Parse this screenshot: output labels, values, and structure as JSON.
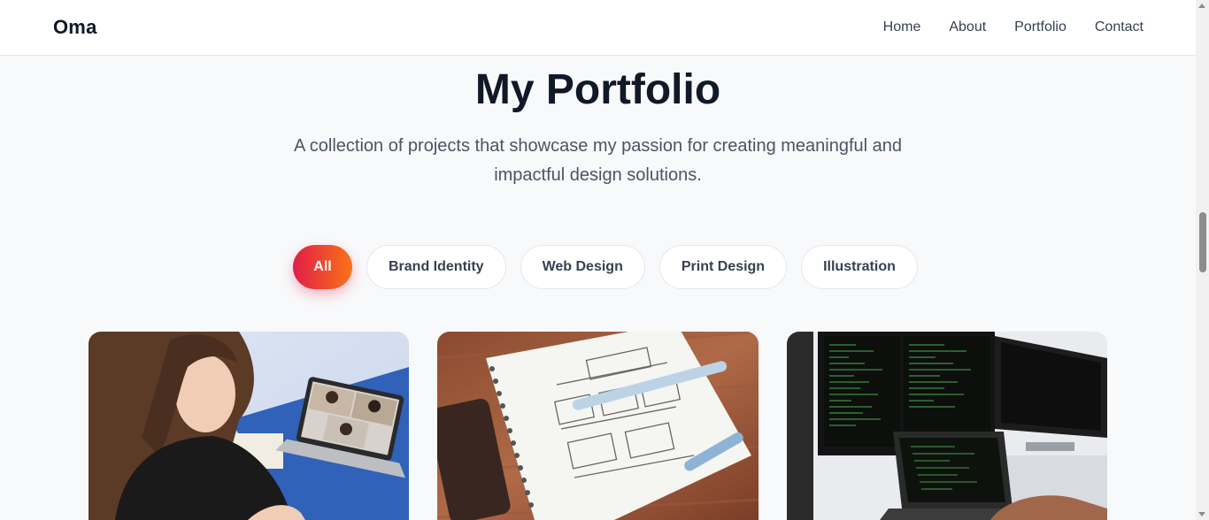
{
  "brand": {
    "logo": "Oma"
  },
  "nav": {
    "items": [
      "Home",
      "About",
      "Portfolio",
      "Contact"
    ]
  },
  "hero": {
    "title": "My Portfolio",
    "subtitle": "A collection of projects that showcase my passion for creating meaningful and impactful design solutions."
  },
  "filters": {
    "items": [
      "All",
      "Brand Identity",
      "Web Design",
      "Print Design",
      "Illustration"
    ],
    "active": "All"
  },
  "projects": [
    {
      "image": "woman-video-call-laptop-photo"
    },
    {
      "image": "wireframe-sketch-notebook-photo"
    },
    {
      "image": "code-monitors-laptop-photo"
    }
  ],
  "colors": {
    "accent_start": "#e11d48",
    "accent_end": "#f97316",
    "background": "#f8f9fa"
  }
}
